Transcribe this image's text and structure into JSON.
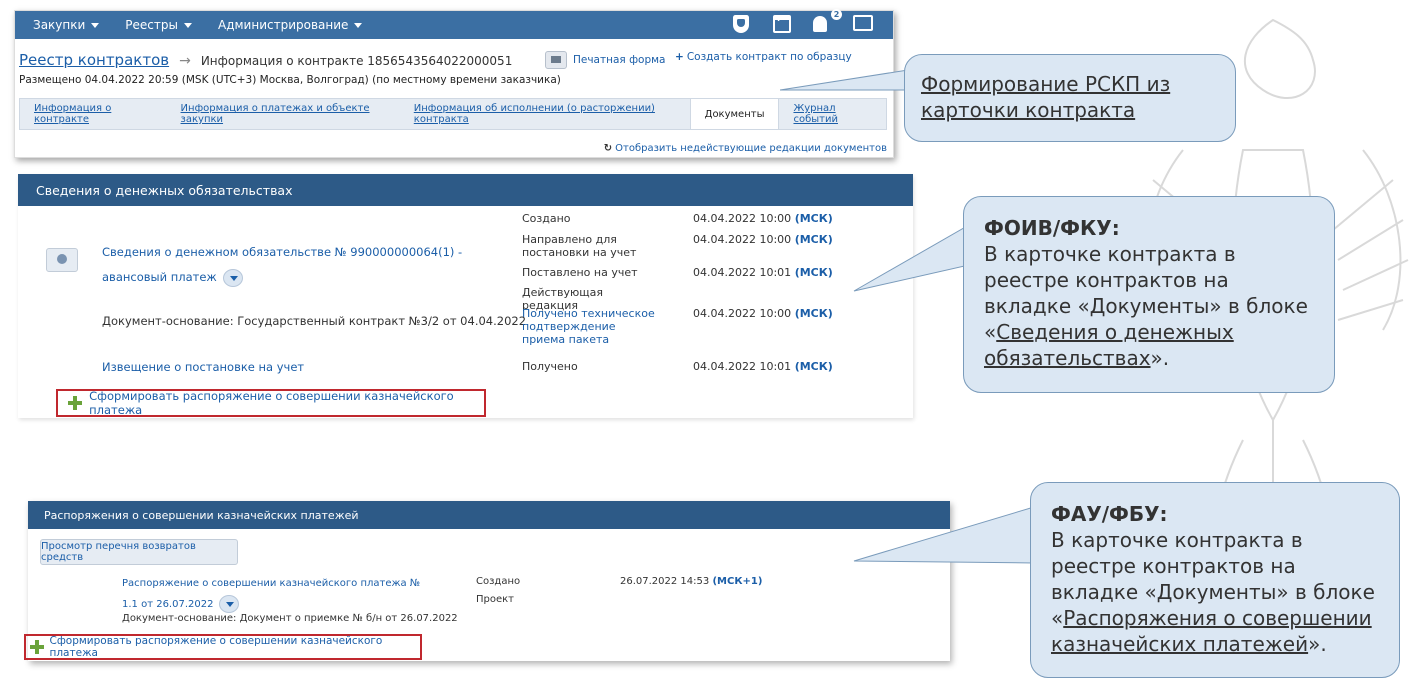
{
  "navbar": {
    "items": [
      "Закупки",
      "Реестры",
      "Администрирование"
    ],
    "notification_count": "2"
  },
  "contract": {
    "registry_link": "Реестр контрактов",
    "breadcrumb_current": "Информация о контракте 1856543564022000051",
    "posted_info": "Размещено 04.04.2022 20:59 (MSK (UTC+3) Москва, Волгоград) (по местному времени заказчика)",
    "print_form": "Печатная форма",
    "create_by_sample": "Создать контракт по образцу",
    "tabs": [
      "Информация о контракте",
      "Информация о платежах и объекте закупки",
      "Информация об исполнении (о расторжении) контракта",
      "Документы",
      "Журнал событий"
    ],
    "active_tab": "Документы",
    "show_inactive": "Отобразить недействующие редакции документов"
  },
  "callouts": {
    "c1": {
      "text": "Формирование РСКП из карточки контракта"
    },
    "c2": {
      "head": "ФОИВ/ФКУ:",
      "text_before": "В карточке контракта в реестре контрактов на вкладке «Документы» в блоке «",
      "link": "Сведения о денежных обязательствах",
      "text_after": "»."
    },
    "c3": {
      "head": "ФАУ/ФБУ:",
      "text_before": "В карточке контракта в реестре контрактов на вкладке «Документы» в блоке «",
      "link": "Распоряжения о совершении казначейских платежей",
      "text_after": "»."
    }
  },
  "monetary": {
    "section_title": "Сведения о денежных обязательствах",
    "obligation_link": "Сведения о денежном обязательстве № 990000000064(1) - авансовый платеж",
    "basis": "Документ-основание: Государственный контракт №3/2 от 04.04.2022",
    "notice_link": "Извещение о постановке на учет",
    "statuses": [
      {
        "label": "Создано",
        "date": "04.04.2022 10:00",
        "tz": "(МСК)"
      },
      {
        "label": "Направлено для постановки на учет",
        "date": "04.04.2022 10:00",
        "tz": "(МСК)"
      },
      {
        "label": "Поставлено на учет",
        "date": "04.04.2022 10:01",
        "tz": "(МСК)"
      },
      {
        "label": "Действующая редакция",
        "date": "",
        "tz": ""
      },
      {
        "label": "Получено техническое подтверждение приема пакета",
        "date": "04.04.2022 10:00",
        "tz": "(МСК)"
      },
      {
        "label": "Получено",
        "date": "04.04.2022 10:01",
        "tz": "(МСК)"
      }
    ],
    "form_button": "Сформировать распоряжение о совершении казначейского платежа"
  },
  "treasury": {
    "section_title": "Распоряжения о совершении казначейских платежей",
    "returns_button": "Просмотр перечня возвратов средств",
    "order_link": "Распоряжение о совершении казначейского платежа № 1.1 от 26.07.2022",
    "basis": "Документ-основание: Документ о приемке № б/н от 26.07.2022",
    "status_created": "Создано",
    "status_draft": "Проект",
    "date": "26.07.2022 14:53",
    "tz": "(МСК+1)",
    "form_button": "Сформировать распоряжение о совершении казначейского платежа"
  },
  "colors": {
    "navbar": "#3b6fa3",
    "section_header": "#2d5a87",
    "link": "#1b5ea8",
    "callout_bg": "#dbe7f3",
    "highlight_border": "#c0282e"
  }
}
